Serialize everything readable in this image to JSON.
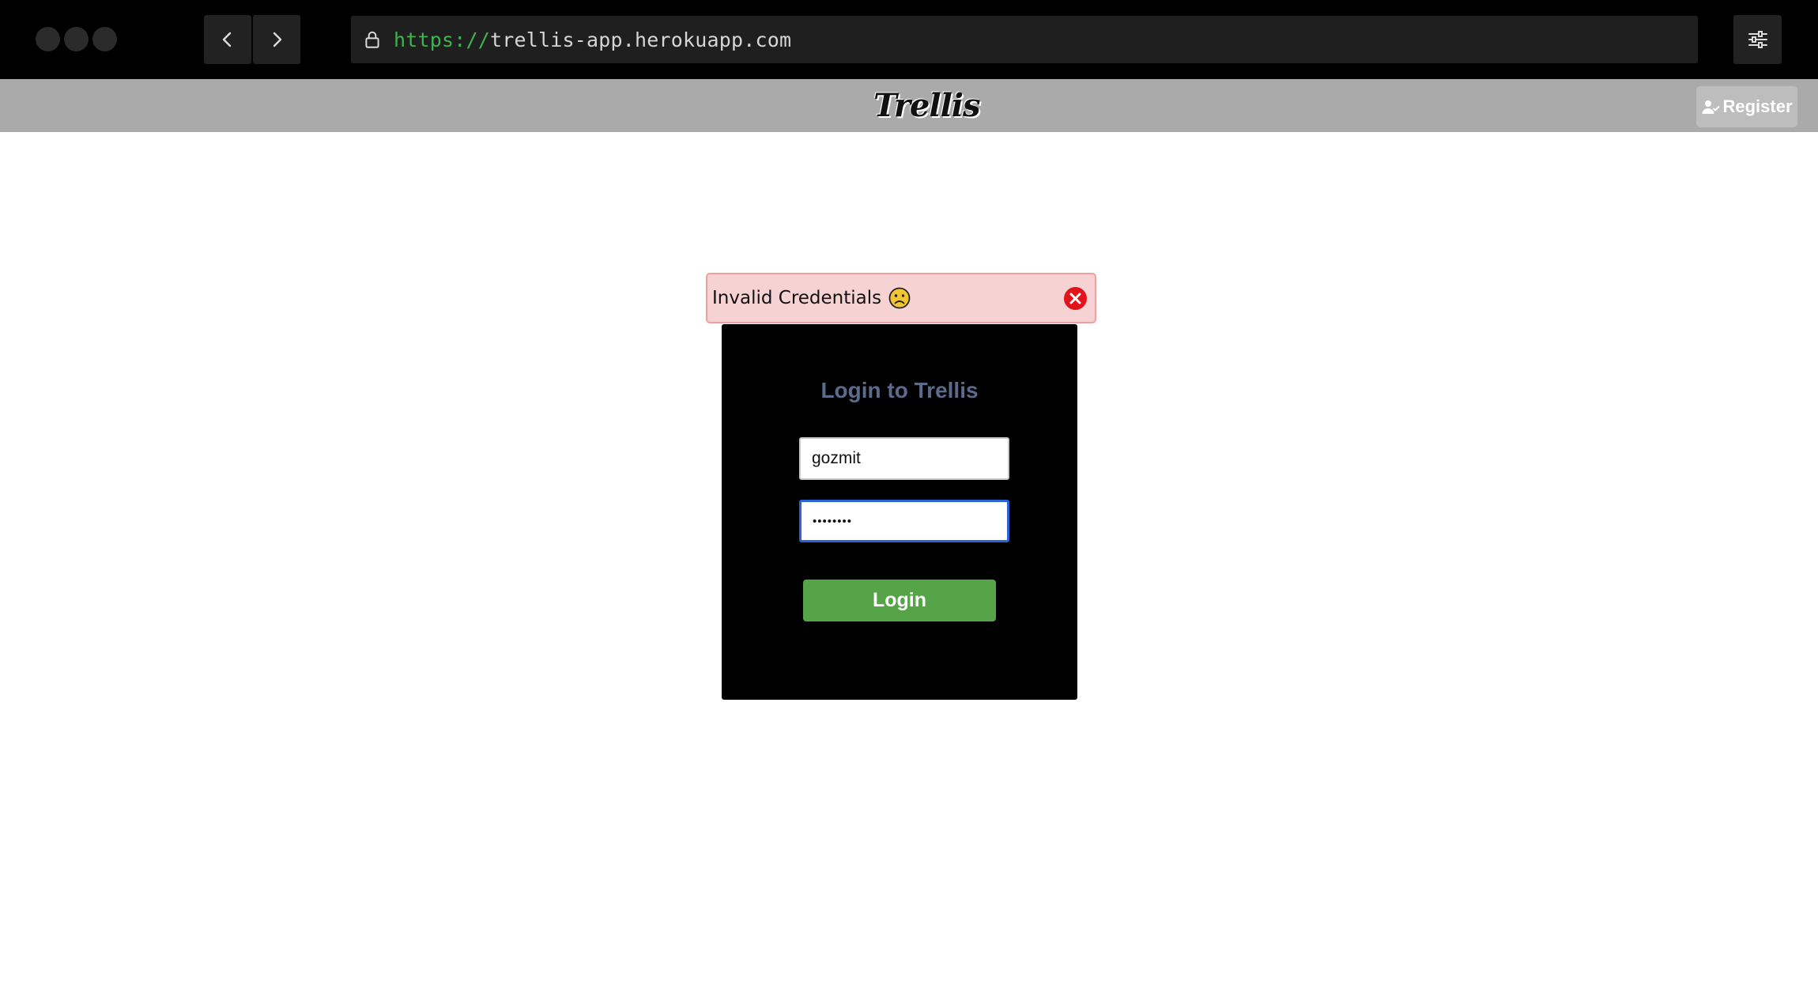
{
  "browser": {
    "url_scheme": "https://",
    "url_host": "trellis-app.herokuapp.com"
  },
  "header": {
    "logo": "Trellis",
    "register_label": "Register"
  },
  "alert": {
    "message": "Invalid Credentials",
    "emoji_icon": "sad-face-icon",
    "close_icon": "close-icon"
  },
  "login": {
    "title": "Login to Trellis",
    "username_value": "gozmit",
    "password_value": "••••••••",
    "button_label": "Login"
  },
  "colors": {
    "header_bg": "#aaaaaa",
    "alert_bg": "#f7d2d2",
    "login_button": "#55a548",
    "title": "#5b6b8b",
    "focus": "#2a62d8"
  }
}
